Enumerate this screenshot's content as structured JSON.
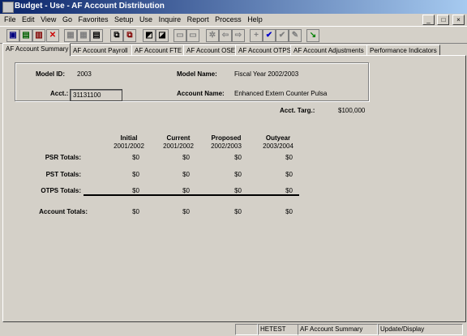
{
  "window": {
    "title": "Budget - Use - AF Account Distribution"
  },
  "window_controls": {
    "minimize": "_",
    "maximize": "□",
    "close": "×"
  },
  "menu": [
    "File",
    "Edit",
    "View",
    "Go",
    "Favorites",
    "Setup",
    "Use",
    "Inquire",
    "Report",
    "Process",
    "Help"
  ],
  "tabs": [
    "AF Account Summary",
    "AF Account Payroll",
    "AF Account FTE",
    "AF Account OSE",
    "AF Account OTPS",
    "AF Account Adjustments",
    "Performance Indicators"
  ],
  "active_tab": "AF Account Summary",
  "header": {
    "model_id_label": "Model ID:",
    "model_id": "2003",
    "model_name_label": "Model Name:",
    "model_name": "Fiscal Year 2002/2003",
    "acct_label": "Acct.:",
    "acct": "31131100",
    "account_name_label": "Account Name:",
    "account_name": "Enhanced Extern Counter Pulsa",
    "acct_targ_label": "Acct. Targ.:",
    "acct_targ": "$100,000"
  },
  "table": {
    "columns": [
      {
        "title": "Initial",
        "years": "2001/2002"
      },
      {
        "title": "Current",
        "years": "2001/2002"
      },
      {
        "title": "Proposed",
        "years": "2002/2003"
      },
      {
        "title": "Outyear",
        "years": "2003/2004"
      }
    ],
    "rows": [
      {
        "label": "PSR Totals:",
        "values": [
          "$0",
          "$0",
          "$0",
          "$0"
        ]
      },
      {
        "label": "PST Totals:",
        "values": [
          "$0",
          "$0",
          "$0",
          "$0"
        ]
      },
      {
        "label": "OTPS Totals:",
        "values": [
          "$0",
          "$0",
          "$0",
          "$0"
        ]
      }
    ],
    "total": {
      "label": "Account Totals:",
      "values": [
        "$0",
        "$0",
        "$0",
        "$0"
      ]
    }
  },
  "status": {
    "user": "HETEST",
    "tab": "AF Account Summary",
    "mode": "Update/Display"
  },
  "toolbar_colors": {
    "save": "#000080",
    "delete": "#cc0000",
    "check": "#0000cc",
    "go": "#008000"
  }
}
